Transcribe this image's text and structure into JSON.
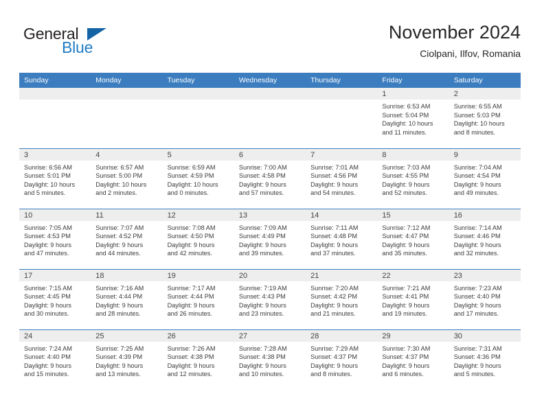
{
  "brand": {
    "word1": "General",
    "word2": "Blue",
    "accent_color": "#1f7cc4",
    "flag_color": "#1464a5"
  },
  "header": {
    "title": "November 2024",
    "subtitle": "Ciolpani, Ilfov, Romania"
  },
  "calendar": {
    "header_bg": "#3b7dbf",
    "daynum_bg": "#eeeeee",
    "weekday_headers": [
      "Sunday",
      "Monday",
      "Tuesday",
      "Wednesday",
      "Thursday",
      "Friday",
      "Saturday"
    ],
    "weeks": [
      [
        {
          "day": "",
          "lines": []
        },
        {
          "day": "",
          "lines": []
        },
        {
          "day": "",
          "lines": []
        },
        {
          "day": "",
          "lines": []
        },
        {
          "day": "",
          "lines": []
        },
        {
          "day": "1",
          "lines": [
            "Sunrise: 6:53 AM",
            "Sunset: 5:04 PM",
            "Daylight: 10 hours",
            "and 11 minutes."
          ]
        },
        {
          "day": "2",
          "lines": [
            "Sunrise: 6:55 AM",
            "Sunset: 5:03 PM",
            "Daylight: 10 hours",
            "and 8 minutes."
          ]
        }
      ],
      [
        {
          "day": "3",
          "lines": [
            "Sunrise: 6:56 AM",
            "Sunset: 5:01 PM",
            "Daylight: 10 hours",
            "and 5 minutes."
          ]
        },
        {
          "day": "4",
          "lines": [
            "Sunrise: 6:57 AM",
            "Sunset: 5:00 PM",
            "Daylight: 10 hours",
            "and 2 minutes."
          ]
        },
        {
          "day": "5",
          "lines": [
            "Sunrise: 6:59 AM",
            "Sunset: 4:59 PM",
            "Daylight: 10 hours",
            "and 0 minutes."
          ]
        },
        {
          "day": "6",
          "lines": [
            "Sunrise: 7:00 AM",
            "Sunset: 4:58 PM",
            "Daylight: 9 hours",
            "and 57 minutes."
          ]
        },
        {
          "day": "7",
          "lines": [
            "Sunrise: 7:01 AM",
            "Sunset: 4:56 PM",
            "Daylight: 9 hours",
            "and 54 minutes."
          ]
        },
        {
          "day": "8",
          "lines": [
            "Sunrise: 7:03 AM",
            "Sunset: 4:55 PM",
            "Daylight: 9 hours",
            "and 52 minutes."
          ]
        },
        {
          "day": "9",
          "lines": [
            "Sunrise: 7:04 AM",
            "Sunset: 4:54 PM",
            "Daylight: 9 hours",
            "and 49 minutes."
          ]
        }
      ],
      [
        {
          "day": "10",
          "lines": [
            "Sunrise: 7:05 AM",
            "Sunset: 4:53 PM",
            "Daylight: 9 hours",
            "and 47 minutes."
          ]
        },
        {
          "day": "11",
          "lines": [
            "Sunrise: 7:07 AM",
            "Sunset: 4:52 PM",
            "Daylight: 9 hours",
            "and 44 minutes."
          ]
        },
        {
          "day": "12",
          "lines": [
            "Sunrise: 7:08 AM",
            "Sunset: 4:50 PM",
            "Daylight: 9 hours",
            "and 42 minutes."
          ]
        },
        {
          "day": "13",
          "lines": [
            "Sunrise: 7:09 AM",
            "Sunset: 4:49 PM",
            "Daylight: 9 hours",
            "and 39 minutes."
          ]
        },
        {
          "day": "14",
          "lines": [
            "Sunrise: 7:11 AM",
            "Sunset: 4:48 PM",
            "Daylight: 9 hours",
            "and 37 minutes."
          ]
        },
        {
          "day": "15",
          "lines": [
            "Sunrise: 7:12 AM",
            "Sunset: 4:47 PM",
            "Daylight: 9 hours",
            "and 35 minutes."
          ]
        },
        {
          "day": "16",
          "lines": [
            "Sunrise: 7:14 AM",
            "Sunset: 4:46 PM",
            "Daylight: 9 hours",
            "and 32 minutes."
          ]
        }
      ],
      [
        {
          "day": "17",
          "lines": [
            "Sunrise: 7:15 AM",
            "Sunset: 4:45 PM",
            "Daylight: 9 hours",
            "and 30 minutes."
          ]
        },
        {
          "day": "18",
          "lines": [
            "Sunrise: 7:16 AM",
            "Sunset: 4:44 PM",
            "Daylight: 9 hours",
            "and 28 minutes."
          ]
        },
        {
          "day": "19",
          "lines": [
            "Sunrise: 7:17 AM",
            "Sunset: 4:44 PM",
            "Daylight: 9 hours",
            "and 26 minutes."
          ]
        },
        {
          "day": "20",
          "lines": [
            "Sunrise: 7:19 AM",
            "Sunset: 4:43 PM",
            "Daylight: 9 hours",
            "and 23 minutes."
          ]
        },
        {
          "day": "21",
          "lines": [
            "Sunrise: 7:20 AM",
            "Sunset: 4:42 PM",
            "Daylight: 9 hours",
            "and 21 minutes."
          ]
        },
        {
          "day": "22",
          "lines": [
            "Sunrise: 7:21 AM",
            "Sunset: 4:41 PM",
            "Daylight: 9 hours",
            "and 19 minutes."
          ]
        },
        {
          "day": "23",
          "lines": [
            "Sunrise: 7:23 AM",
            "Sunset: 4:40 PM",
            "Daylight: 9 hours",
            "and 17 minutes."
          ]
        }
      ],
      [
        {
          "day": "24",
          "lines": [
            "Sunrise: 7:24 AM",
            "Sunset: 4:40 PM",
            "Daylight: 9 hours",
            "and 15 minutes."
          ]
        },
        {
          "day": "25",
          "lines": [
            "Sunrise: 7:25 AM",
            "Sunset: 4:39 PM",
            "Daylight: 9 hours",
            "and 13 minutes."
          ]
        },
        {
          "day": "26",
          "lines": [
            "Sunrise: 7:26 AM",
            "Sunset: 4:38 PM",
            "Daylight: 9 hours",
            "and 12 minutes."
          ]
        },
        {
          "day": "27",
          "lines": [
            "Sunrise: 7:28 AM",
            "Sunset: 4:38 PM",
            "Daylight: 9 hours",
            "and 10 minutes."
          ]
        },
        {
          "day": "28",
          "lines": [
            "Sunrise: 7:29 AM",
            "Sunset: 4:37 PM",
            "Daylight: 9 hours",
            "and 8 minutes."
          ]
        },
        {
          "day": "29",
          "lines": [
            "Sunrise: 7:30 AM",
            "Sunset: 4:37 PM",
            "Daylight: 9 hours",
            "and 6 minutes."
          ]
        },
        {
          "day": "30",
          "lines": [
            "Sunrise: 7:31 AM",
            "Sunset: 4:36 PM",
            "Daylight: 9 hours",
            "and 5 minutes."
          ]
        }
      ]
    ]
  }
}
